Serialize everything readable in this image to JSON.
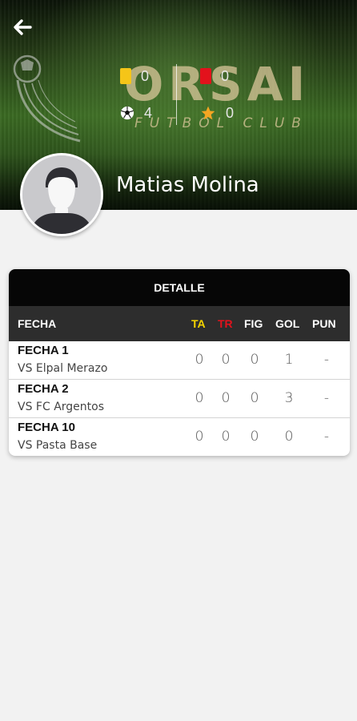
{
  "header": {
    "back_icon": "arrow-left-icon",
    "brand_main": "ORSAI",
    "brand_sub": "FUTBOL CLUB",
    "stats": {
      "yellow_cards": "0",
      "red_cards": "0",
      "goals": "4",
      "stars": "0"
    },
    "colors": {
      "yellow_card": "#f5c518",
      "red_card": "#e3121c",
      "star": "#f5a623"
    }
  },
  "player": {
    "name": "Matias Molina",
    "avatar_icon": "person-placeholder-icon"
  },
  "table": {
    "title": "DETALLE",
    "columns": {
      "fecha": "FECHA",
      "ta": "TA",
      "tr": "TR",
      "fig": "FIG",
      "gol": "GOL",
      "pun": "PUN"
    },
    "column_colors": {
      "ta": "#f5d400",
      "tr": "#e3121c"
    },
    "rows": [
      {
        "fecha": "FECHA 1",
        "vs": "VS Elpal Merazo",
        "ta": "0",
        "tr": "0",
        "fig": "0",
        "gol": "1",
        "pun": "-"
      },
      {
        "fecha": "FECHA 2",
        "vs": "VS FC Argentos",
        "ta": "0",
        "tr": "0",
        "fig": "0",
        "gol": "3",
        "pun": "-"
      },
      {
        "fecha": "FECHA 10",
        "vs": "VS Pasta Base",
        "ta": "0",
        "tr": "0",
        "fig": "0",
        "gol": "0",
        "pun": "-"
      }
    ]
  }
}
